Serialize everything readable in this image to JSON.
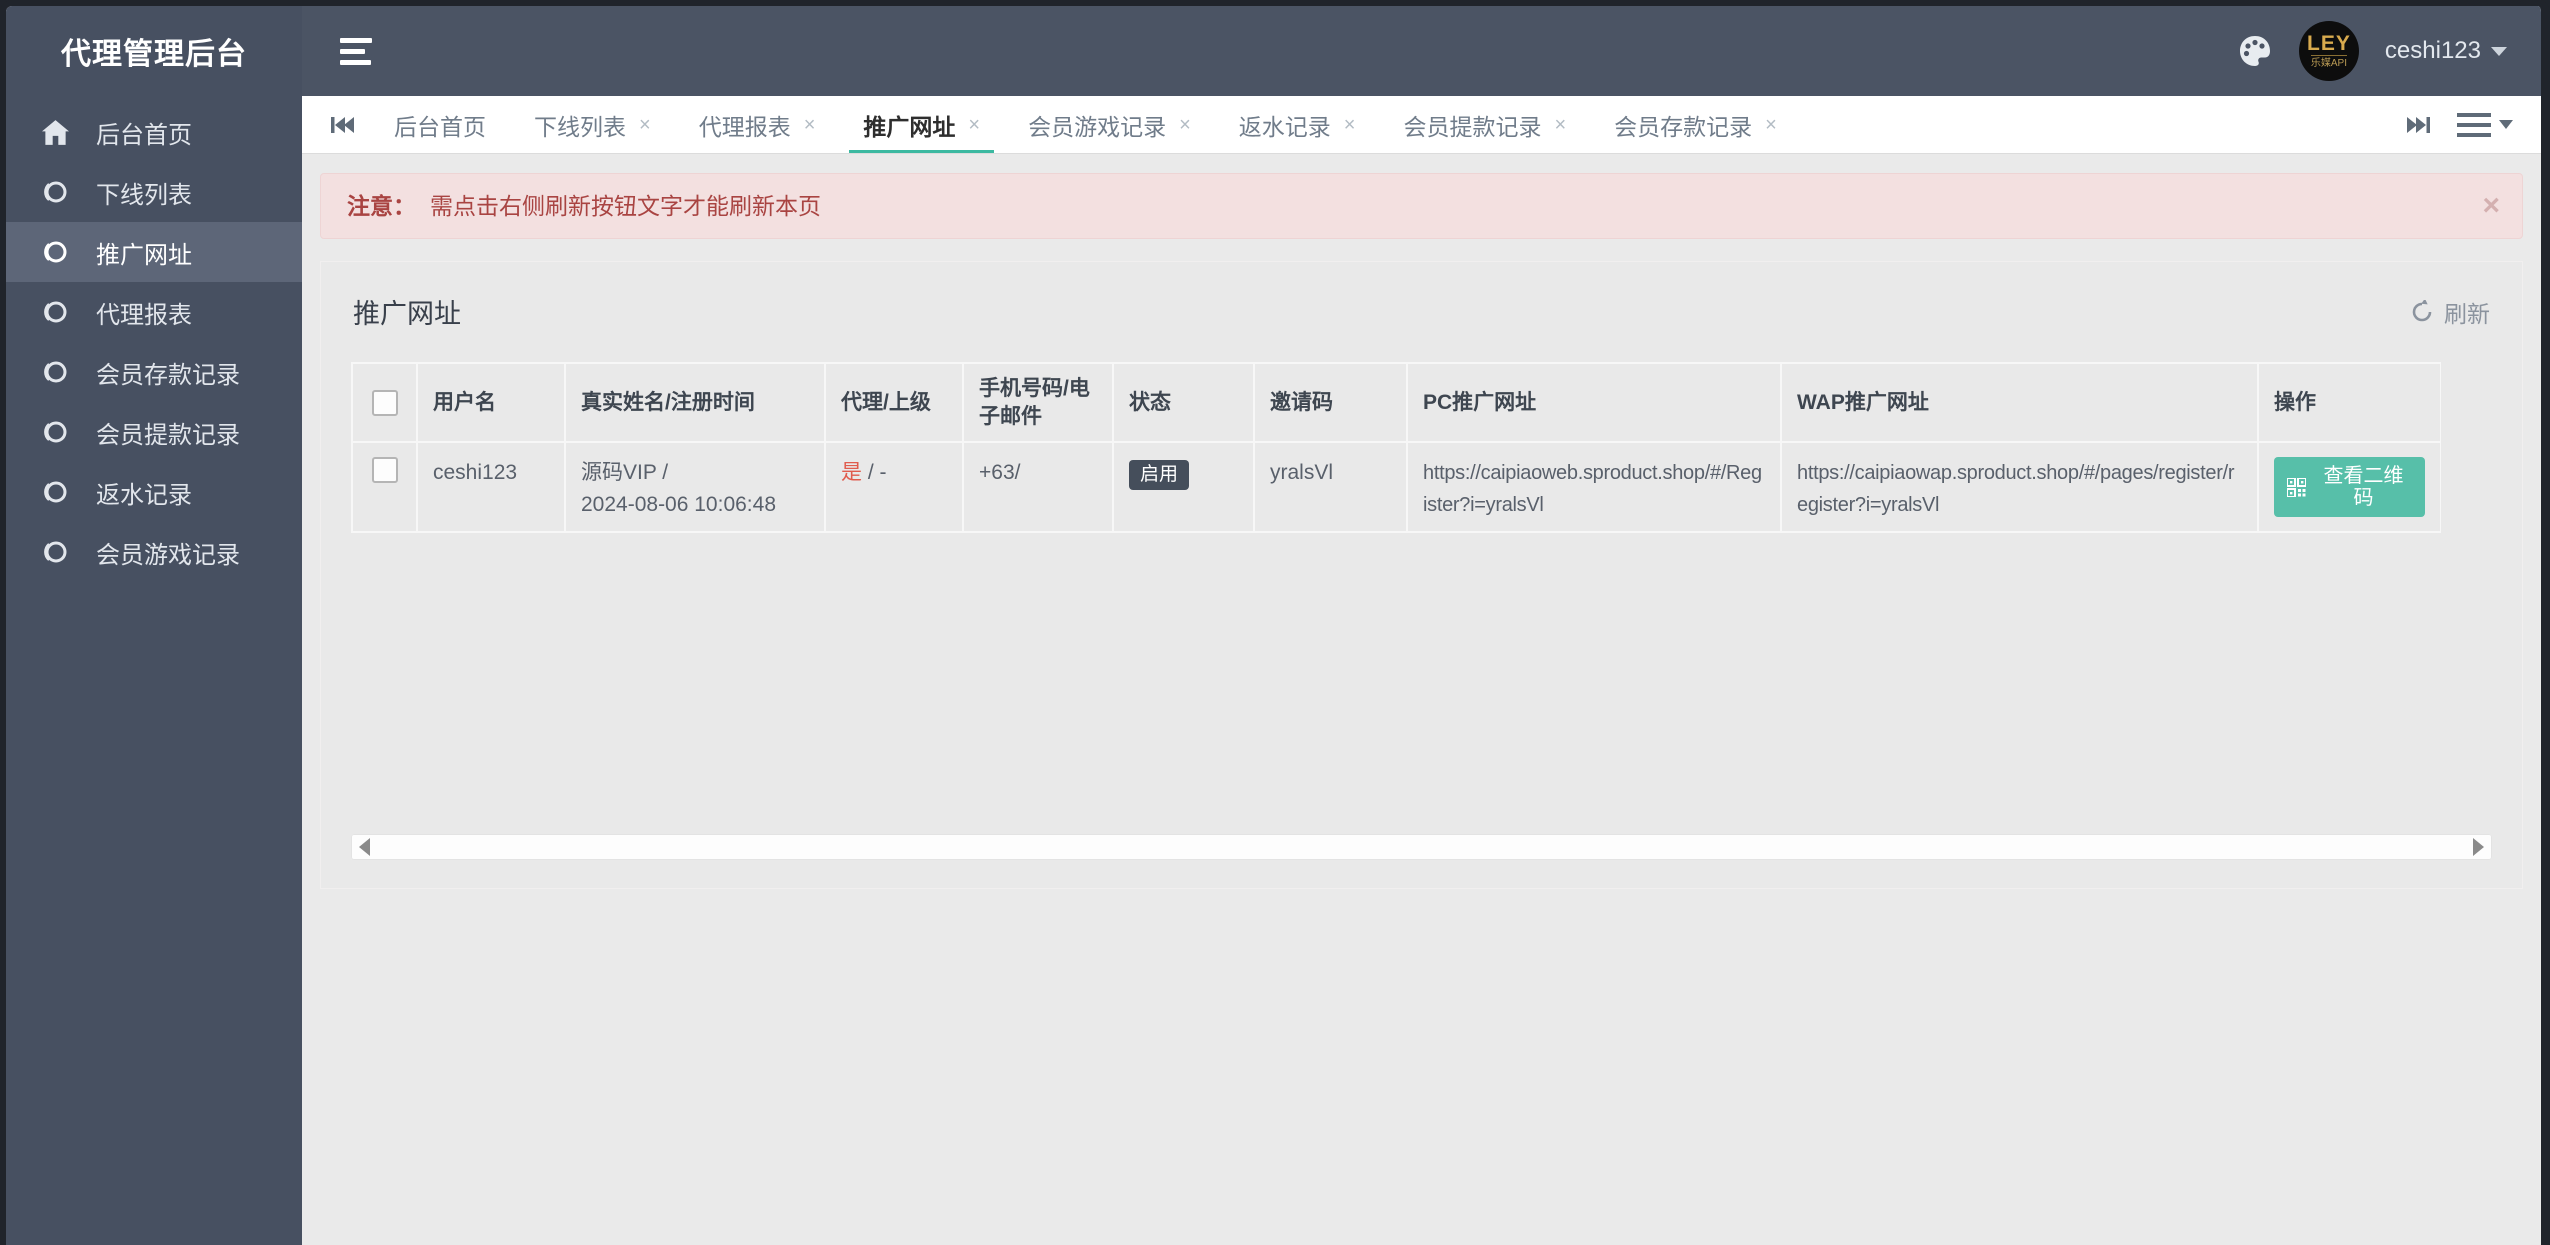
{
  "app_title": "代理管理后台",
  "topbar": {
    "username": "ceshi123",
    "avatar_line1": "LEY",
    "avatar_line2": "乐媒API"
  },
  "sidebar": {
    "items": [
      {
        "label": "后台首页",
        "icon": "home-icon",
        "active": false
      },
      {
        "label": "下线列表",
        "icon": "circle-icon",
        "active": false
      },
      {
        "label": "推广网址",
        "icon": "circle-icon",
        "active": true
      },
      {
        "label": "代理报表",
        "icon": "circle-icon",
        "active": false
      },
      {
        "label": "会员存款记录",
        "icon": "circle-icon",
        "active": false
      },
      {
        "label": "会员提款记录",
        "icon": "circle-icon",
        "active": false
      },
      {
        "label": "返水记录",
        "icon": "circle-icon",
        "active": false
      },
      {
        "label": "会员游戏记录",
        "icon": "circle-icon",
        "active": false
      }
    ]
  },
  "tabbar": {
    "close_glyph": "×",
    "tabs": [
      {
        "label": "后台首页",
        "closable": false,
        "active": false
      },
      {
        "label": "下线列表",
        "closable": true,
        "active": false
      },
      {
        "label": "代理报表",
        "closable": true,
        "active": false
      },
      {
        "label": "推广网址",
        "closable": true,
        "active": true
      },
      {
        "label": "会员游戏记录",
        "closable": true,
        "active": false
      },
      {
        "label": "返水记录",
        "closable": true,
        "active": false
      },
      {
        "label": "会员提款记录",
        "closable": true,
        "active": false
      },
      {
        "label": "会员存款记录",
        "closable": true,
        "active": false
      }
    ]
  },
  "alert": {
    "label": "注意：",
    "message": "需点击右侧刷新按钮文字才能刷新本页",
    "close_glyph": "×"
  },
  "panel": {
    "title": "推广网址",
    "refresh_label": "刷新"
  },
  "table": {
    "headers": [
      "用户名",
      "真实姓名/注册时间",
      "代理/上级",
      "手机号码/电子邮件",
      "状态",
      "邀请码",
      "PC推广网址",
      "WAP推广网址",
      "操作"
    ],
    "row": {
      "username": "ceshi123",
      "realname": "源码VIP /",
      "register_time": "2024-08-06 10:06:48",
      "is_agent": "是",
      "agent_suffix": "/ -",
      "phone_email": "+63/",
      "status": "启用",
      "invite_code": "yralsVl",
      "pc_url": "https://caipiaoweb.sproduct.shop/#/Register?i=yralsVl",
      "wap_url": "https://caipiaowap.sproduct.shop/#/pages/register/register?i=yralsVl",
      "action_label": "查看二维码"
    }
  },
  "colors": {
    "sidebar_bg": "#475061",
    "topbar_bg": "#4b5464",
    "accent_teal": "#3cb9a1",
    "alert_bg": "#f3e0e0",
    "alert_text": "#a94442",
    "badge_bg": "#454e5b",
    "button_bg": "#57bfa9"
  }
}
